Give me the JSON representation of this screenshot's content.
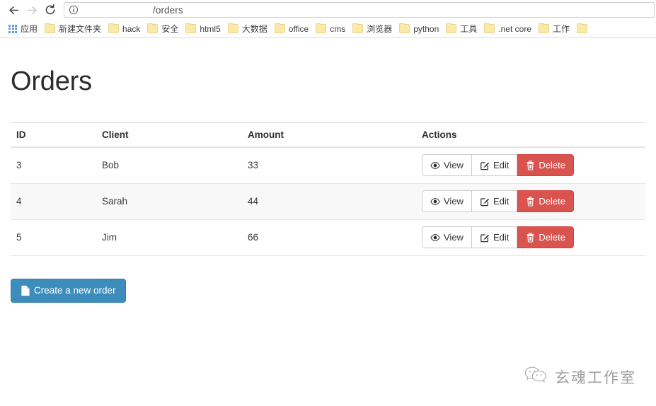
{
  "browser": {
    "nav": {
      "back_title": "Back",
      "forward_title": "Forward",
      "reload_title": "Reload"
    },
    "omnibox": {
      "info_icon": "info-circle-icon",
      "url_redacted_label": "",
      "url_path": "/orders"
    },
    "bookmarks": [
      {
        "label": "应用",
        "icon": "apps-grid-icon"
      },
      {
        "label": "新建文件夹",
        "icon": "folder-icon"
      },
      {
        "label": "hack",
        "icon": "folder-icon"
      },
      {
        "label": "安全",
        "icon": "folder-icon"
      },
      {
        "label": "html5",
        "icon": "folder-icon"
      },
      {
        "label": "大数据",
        "icon": "folder-icon"
      },
      {
        "label": "office",
        "icon": "folder-icon"
      },
      {
        "label": "cms",
        "icon": "folder-icon"
      },
      {
        "label": "浏览器",
        "icon": "folder-icon"
      },
      {
        "label": "python",
        "icon": "folder-icon"
      },
      {
        "label": "工具",
        "icon": "folder-icon"
      },
      {
        "label": ".net core",
        "icon": "folder-icon"
      },
      {
        "label": "工作",
        "icon": "folder-icon"
      },
      {
        "label": "",
        "icon": "folder-icon"
      }
    ]
  },
  "page": {
    "title": "Orders",
    "table": {
      "headers": [
        "ID",
        "Client",
        "Amount",
        "Actions"
      ],
      "rows": [
        {
          "id": "3",
          "client": "Bob",
          "amount": "33"
        },
        {
          "id": "4",
          "client": "Sarah",
          "amount": "44"
        },
        {
          "id": "5",
          "client": "Jim",
          "amount": "66"
        }
      ],
      "actions": {
        "view_label": "View",
        "edit_label": "Edit",
        "delete_label": "Delete",
        "view_icon": "eye-icon",
        "edit_icon": "pen-to-square-icon",
        "delete_icon": "trash-icon"
      }
    },
    "create_button": {
      "label": "Create a new order",
      "icon": "file-icon"
    }
  },
  "watermark": {
    "icon": "wechat-icon",
    "text": "玄魂工作室"
  },
  "colors": {
    "danger": "#d9534f",
    "primary": "#3c8dbc",
    "redaction": "#f22b2b",
    "folder": "#fbe9a8",
    "striped_row": "#f8f8f8"
  }
}
